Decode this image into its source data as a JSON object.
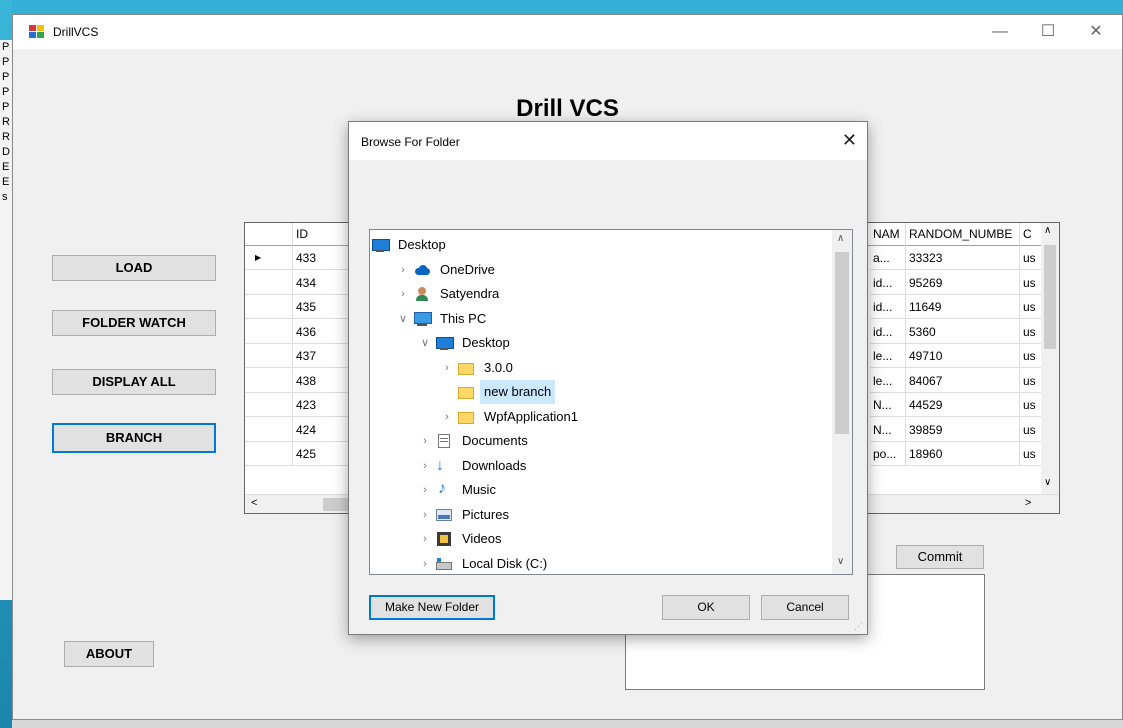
{
  "window": {
    "title": "DrillVCS"
  },
  "heading": "Drill VCS",
  "buttons": {
    "load": "LOAD",
    "folder_watch": "FOLDER WATCH",
    "display_all": "DISPLAY ALL",
    "branch": "BRANCH",
    "about": "ABOUT",
    "commit": "Commit"
  },
  "side_letters": [
    "P",
    "P",
    "P",
    "P",
    "P",
    "R",
    "R",
    "D",
    "E",
    "",
    "",
    "E",
    "",
    "",
    "",
    "",
    "",
    "",
    "",
    "",
    "",
    "",
    "s"
  ],
  "grid": {
    "columns": [
      "ID",
      "NAM",
      "RANDOM_NUMBE",
      "C"
    ],
    "rows": [
      {
        "id": "433",
        "name": "a...",
        "num": "33323",
        "c": "us"
      },
      {
        "id": "434",
        "name": "id...",
        "num": "95269",
        "c": "us"
      },
      {
        "id": "435",
        "name": "id...",
        "num": "11649",
        "c": "us"
      },
      {
        "id": "436",
        "name": "id...",
        "num": "5360",
        "c": "us"
      },
      {
        "id": "437",
        "name": "le...",
        "num": "49710",
        "c": "us"
      },
      {
        "id": "438",
        "name": "le...",
        "num": "84067",
        "c": "us"
      },
      {
        "id": "423",
        "name": "N...",
        "num": "44529",
        "c": "us"
      },
      {
        "id": "424",
        "name": "N...",
        "num": "39859",
        "c": "us"
      },
      {
        "id": "425",
        "name": "po...",
        "num": "18960",
        "c": "us"
      }
    ]
  },
  "dialog": {
    "title": "Browse For Folder",
    "make_new_folder": "Make New Folder",
    "ok": "OK",
    "cancel": "Cancel",
    "tree": [
      {
        "label": "Desktop",
        "icon": "desktop-icon",
        "level": 0,
        "expander": ""
      },
      {
        "label": "OneDrive",
        "icon": "cloud-icon",
        "level": 1,
        "expander": ">"
      },
      {
        "label": "Satyendra",
        "icon": "user-icon",
        "level": 1,
        "expander": ">"
      },
      {
        "label": "This PC",
        "icon": "computer-icon",
        "level": 1,
        "expander": "v"
      },
      {
        "label": "Desktop",
        "icon": "desktop-icon",
        "level": 2,
        "expander": "v"
      },
      {
        "label": "3.0.0",
        "icon": "folder-icon",
        "level": 3,
        "expander": ">"
      },
      {
        "label": "new branch",
        "icon": "folder-icon",
        "level": 3,
        "expander": "",
        "selected": true
      },
      {
        "label": "WpfApplication1",
        "icon": "folder-icon",
        "level": 3,
        "expander": ">"
      },
      {
        "label": "Documents",
        "icon": "documents-icon",
        "level": 2,
        "expander": ">"
      },
      {
        "label": "Downloads",
        "icon": "download-icon",
        "level": 2,
        "expander": ">"
      },
      {
        "label": "Music",
        "icon": "music-icon",
        "level": 2,
        "expander": ">"
      },
      {
        "label": "Pictures",
        "icon": "pictures-icon",
        "level": 2,
        "expander": ">"
      },
      {
        "label": "Videos",
        "icon": "videos-icon",
        "level": 2,
        "expander": ">"
      },
      {
        "label": "Local Disk (C:)",
        "icon": "disk-icon",
        "level": 2,
        "expander": ">"
      }
    ]
  }
}
